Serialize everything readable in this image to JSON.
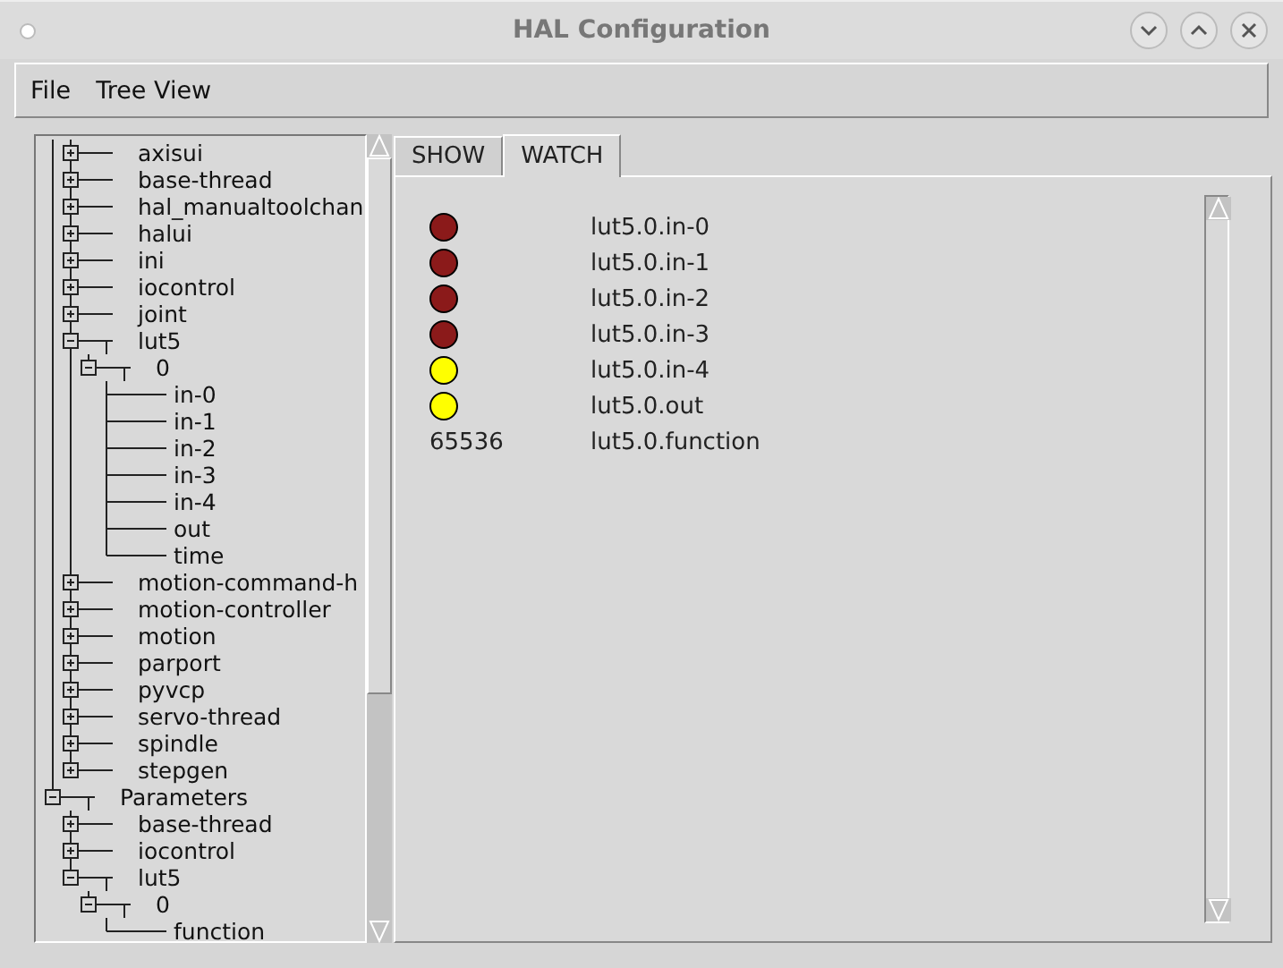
{
  "window": {
    "title": "HAL Configuration"
  },
  "menu": [
    "File",
    "Tree View"
  ],
  "tree": [
    {
      "children": [
        {
          "label": "axisui",
          "expanded": false
        },
        {
          "label": "base-thread",
          "expanded": false
        },
        {
          "label": "hal_manualtoolchan",
          "expanded": false
        },
        {
          "label": "halui",
          "expanded": false
        },
        {
          "label": "ini",
          "expanded": false
        },
        {
          "label": "iocontrol",
          "expanded": false
        },
        {
          "label": "joint",
          "expanded": false
        },
        {
          "label": "lut5",
          "expanded": true,
          "children": [
            {
              "label": "0",
              "expanded": true,
              "children": [
                {
                  "label": "in-0"
                },
                {
                  "label": "in-1"
                },
                {
                  "label": "in-2"
                },
                {
                  "label": "in-3"
                },
                {
                  "label": "in-4"
                },
                {
                  "label": "out"
                },
                {
                  "label": "time"
                }
              ]
            }
          ]
        },
        {
          "label": "motion-command-h",
          "expanded": false
        },
        {
          "label": "motion-controller",
          "expanded": false
        },
        {
          "label": "motion",
          "expanded": false
        },
        {
          "label": "parport",
          "expanded": false
        },
        {
          "label": "pyvcp",
          "expanded": false
        },
        {
          "label": "servo-thread",
          "expanded": false
        },
        {
          "label": "spindle",
          "expanded": false
        },
        {
          "label": "stepgen",
          "expanded": false
        }
      ]
    },
    {
      "label": "Parameters",
      "expanded": true,
      "children": [
        {
          "label": "base-thread",
          "expanded": false
        },
        {
          "label": "iocontrol",
          "expanded": false
        },
        {
          "label": "lut5",
          "expanded": true,
          "children": [
            {
              "label": "0",
              "expanded": true,
              "children": [
                {
                  "label": "function"
                }
              ]
            }
          ]
        }
      ]
    }
  ],
  "tabs": [
    {
      "label": "SHOW",
      "selected": false
    },
    {
      "label": "WATCH",
      "selected": true
    }
  ],
  "watch": [
    {
      "kind": "bit",
      "on": false,
      "name": "lut5.0.in-0"
    },
    {
      "kind": "bit",
      "on": false,
      "name": "lut5.0.in-1"
    },
    {
      "kind": "bit",
      "on": false,
      "name": "lut5.0.in-2"
    },
    {
      "kind": "bit",
      "on": false,
      "name": "lut5.0.in-3"
    },
    {
      "kind": "bit",
      "on": true,
      "name": "lut5.0.in-4"
    },
    {
      "kind": "bit",
      "on": true,
      "name": "lut5.0.out"
    },
    {
      "kind": "value",
      "value": "65536",
      "name": "lut5.0.function"
    }
  ]
}
